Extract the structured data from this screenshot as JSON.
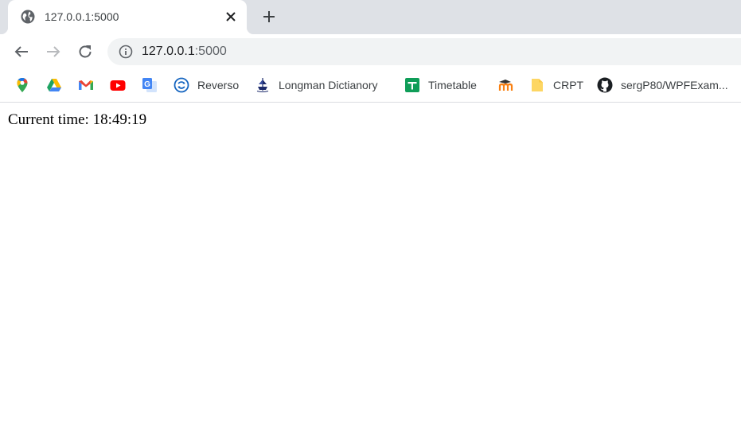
{
  "tab": {
    "title": "127.0.0.1:5000",
    "favicon": "globe-icon"
  },
  "toolbar": {
    "back_icon": "back-arrow-icon",
    "forward_icon": "forward-arrow-icon",
    "reload_icon": "reload-icon",
    "url_host": "127.0.0.1",
    "url_port": ":5000"
  },
  "bookmarks": [
    {
      "icon": "google-maps-icon",
      "label": ""
    },
    {
      "icon": "google-drive-icon",
      "label": ""
    },
    {
      "icon": "gmail-icon",
      "label": ""
    },
    {
      "icon": "youtube-icon",
      "label": ""
    },
    {
      "icon": "google-translate-icon",
      "label": ""
    },
    {
      "icon": "reverso-icon",
      "label": "Reverso"
    },
    {
      "icon": "longman-icon",
      "label": "Longman Dictianory"
    },
    {
      "icon": "google-sheets-icon",
      "label": "Timetable"
    },
    {
      "icon": "moodle-icon",
      "label": ""
    },
    {
      "icon": "folder-icon",
      "label": "CRPT"
    },
    {
      "icon": "github-icon",
      "label": "sergP80/WPFExam..."
    }
  ],
  "page": {
    "current_time_label": "Current time: ",
    "current_time_value": "18:49:19"
  },
  "colors": {
    "tabstrip_bg": "#dee1e6",
    "omnibox_bg": "#f1f3f4",
    "text": "#3c4043"
  }
}
